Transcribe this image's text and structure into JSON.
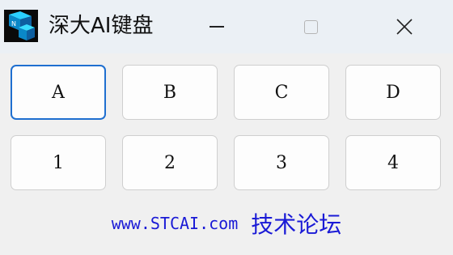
{
  "window": {
    "title": "深大AI键盘",
    "minimize_icon": "minimize-icon",
    "maximize_icon": "maximize-icon",
    "close_icon": "close-icon",
    "close_glyph": "✕"
  },
  "keys": {
    "row1": [
      "A",
      "B",
      "C",
      "D"
    ],
    "row2": [
      "1",
      "2",
      "3",
      "4"
    ]
  },
  "footer": {
    "site": "www.STCAI.com",
    "forum": "技术论坛"
  },
  "colors": {
    "link": "#1a1ad6",
    "focus_border": "#1f6fd0"
  }
}
